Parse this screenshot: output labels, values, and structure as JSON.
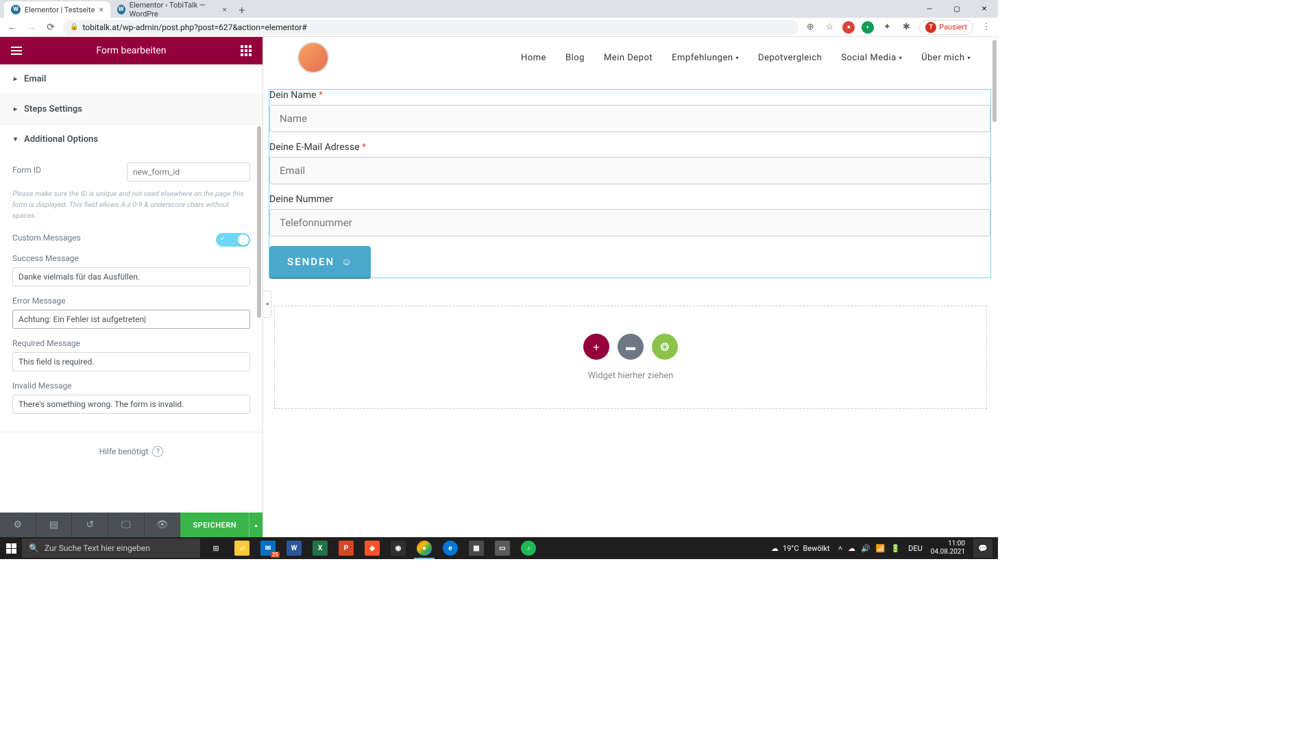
{
  "browser": {
    "tabs": [
      {
        "title": "Elementor | Testseite",
        "active": true
      },
      {
        "title": "Elementor ‹ TobiTalk — WordPre",
        "active": false
      }
    ],
    "url": "tobitalk.at/wp-admin/post.php?post=627&action=elementor#",
    "pause_label": "Pausiert",
    "pause_initial": "T"
  },
  "sidebar": {
    "title": "Form bearbeiten",
    "sections": {
      "email": "Email",
      "steps": "Steps Settings",
      "additional": "Additional Options"
    },
    "form_id_label": "Form ID",
    "form_id_placeholder": "new_form_id",
    "form_id_help": "Please make sure the ID is unique and not used elsewhere on the page this form is displayed. This field allows A-z 0-9 & underscore chars without spaces.",
    "custom_messages_label": "Custom Messages",
    "success_label": "Success Message",
    "success_value": "Danke vielmals für das Ausfüllen.",
    "error_label": "Error Message",
    "error_value": "Achtung: Ein Fehler ist aufgetreten|",
    "required_label": "Required Message",
    "required_value": "This field is required.",
    "invalid_label": "Invalid Message",
    "invalid_value": "There's something wrong. The form is invalid.",
    "help": "Hilfe benötigt",
    "save": "SPEICHERN"
  },
  "nav": {
    "items": [
      "Home",
      "Blog",
      "Mein Depot",
      "Empfehlungen",
      "Depotvergleich",
      "Social Media",
      "Über mich"
    ],
    "dropdowns": [
      3,
      5,
      6
    ]
  },
  "form": {
    "name_label": "Dein Name",
    "name_placeholder": "Name",
    "email_label": "Deine E-Mail Adresse",
    "email_placeholder": "Email",
    "phone_label": "Deine Nummer",
    "phone_placeholder": "Telefonnummer",
    "send": "SENDEN"
  },
  "dropzone": {
    "text": "Widget hierher ziehen"
  },
  "taskbar": {
    "search_placeholder": "Zur Suche Text hier eingeben",
    "weather_temp": "19°C",
    "weather_desc": "Bewölkt",
    "lang": "DEU",
    "time": "11:00",
    "date": "04.08.2021",
    "badge": "25"
  }
}
